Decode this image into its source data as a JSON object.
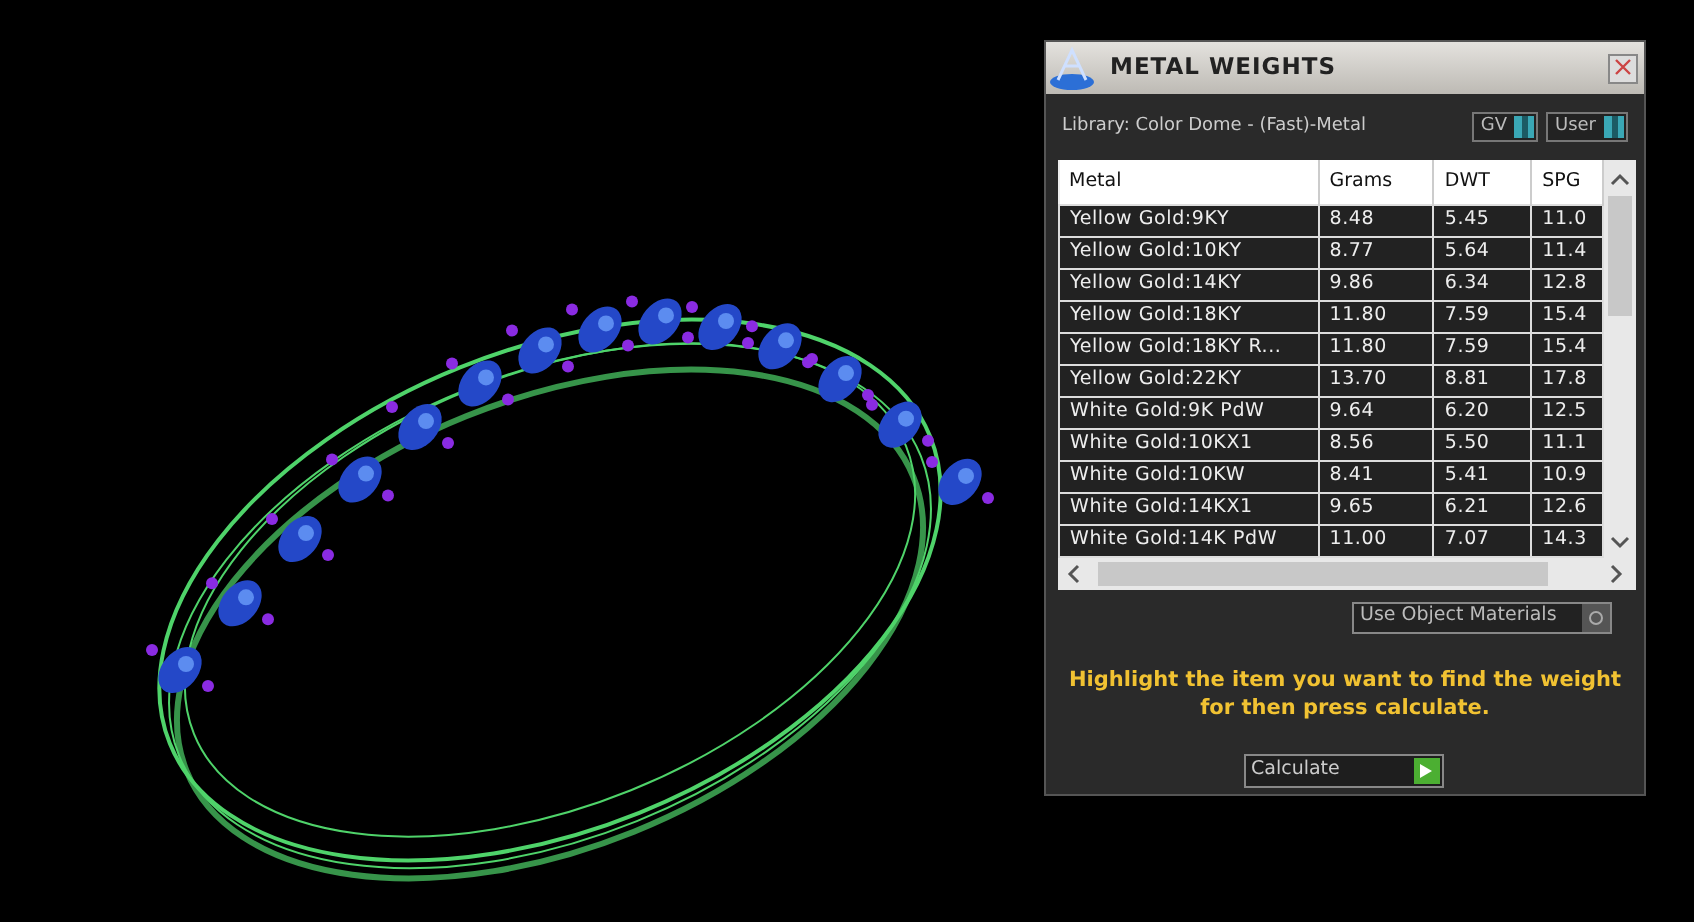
{
  "panel": {
    "title": "METAL WEIGHTS",
    "library": "Library: Color Dome - (Fast)-Metal",
    "toggles": [
      {
        "label": "GV",
        "on": true
      },
      {
        "label": "User",
        "on": true
      }
    ],
    "table": {
      "columns": [
        "Metal",
        "Grams",
        "DWT",
        "SPG"
      ],
      "rows": [
        [
          "Yellow Gold:9KY",
          "8.48",
          "5.45",
          "11.0"
        ],
        [
          "Yellow Gold:10KY",
          "8.77",
          "5.64",
          "11.4"
        ],
        [
          "Yellow Gold:14KY",
          "9.86",
          "6.34",
          "12.8"
        ],
        [
          "Yellow Gold:18KY",
          "11.80",
          "7.59",
          "15.4"
        ],
        [
          "Yellow Gold:18KY R...",
          "11.80",
          "7.59",
          "15.4"
        ],
        [
          "Yellow Gold:22KY",
          "13.70",
          "8.81",
          "17.8"
        ],
        [
          "White Gold:9K PdW",
          "9.64",
          "6.20",
          "12.5"
        ],
        [
          "White Gold:10KX1",
          "8.56",
          "5.50",
          "11.1"
        ],
        [
          "White Gold:10KW",
          "8.41",
          "5.41",
          "10.9"
        ],
        [
          "White Gold:14KX1",
          "9.65",
          "6.21",
          "12.6"
        ],
        [
          "White Gold:14K PdW",
          "11.00",
          "7.07",
          "14.3"
        ]
      ]
    },
    "use_object_materials": {
      "label": "Use Object Materials",
      "on": false
    },
    "hint": "Highlight the item you want to find the weight for then press calculate.",
    "calculate": "Calculate"
  }
}
